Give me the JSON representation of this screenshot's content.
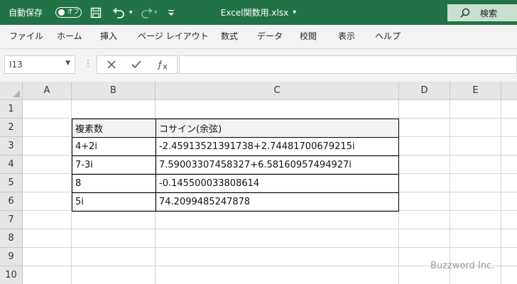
{
  "titlebar": {
    "autosave_label": "自動保存",
    "autosave_state": "オフ",
    "filename": "Excel関数用.xlsx",
    "filename_dropdown": "▾",
    "search_label": "検索",
    "colors": {
      "bar": "#217346",
      "search": "#c7e0d0"
    }
  },
  "ribbon": {
    "tabs": [
      "ファイル",
      "ホーム",
      "挿入",
      "ページ レイアウト",
      "数式",
      "データ",
      "校閲",
      "表示",
      "ヘルプ"
    ]
  },
  "formula_bar": {
    "name_box": "I13",
    "formula": ""
  },
  "grid": {
    "columns": [
      "A",
      "B",
      "C",
      "D",
      "E"
    ],
    "rows": [
      "1",
      "2",
      "3",
      "4",
      "5",
      "6",
      "7",
      "8",
      "9",
      "10"
    ],
    "table": {
      "header": [
        "複素数",
        "コサイン(余弦)"
      ],
      "rows": [
        [
          "4+2i",
          "-2.45913521391738+2.74481700679215i"
        ],
        [
          "7-3i",
          "7.59003307458327+6.58160957494927i"
        ],
        [
          "8",
          "-0.145500033808614"
        ],
        [
          "5i",
          "74.2099485247878"
        ]
      ]
    }
  },
  "watermark": "Buzzword Inc."
}
